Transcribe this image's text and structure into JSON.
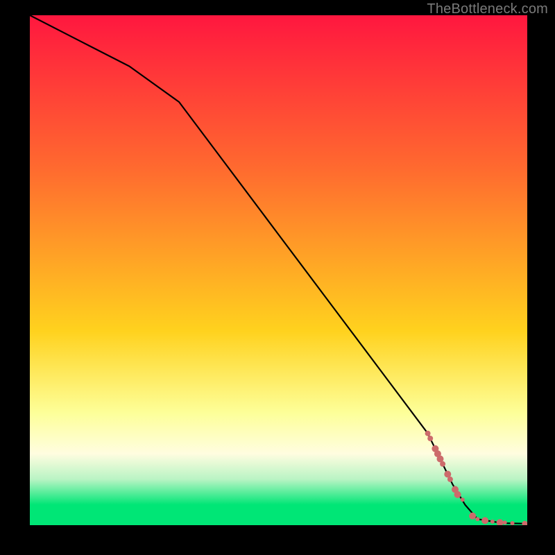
{
  "attribution": "TheBottleneck.com",
  "colors": {
    "top": "#ff173f",
    "mid1": "#ff6a2f",
    "mid2": "#ffd21e",
    "band_pale": "#fdff99",
    "band_cream": "#fffde0",
    "band_mint": "#b9f4c4",
    "green": "#00e676",
    "line": "#000000",
    "marker": "#cc6b6b"
  },
  "chart_data": {
    "type": "line",
    "title": "",
    "xlabel": "",
    "ylabel": "",
    "xlim": [
      0,
      100
    ],
    "ylim": [
      0,
      100
    ],
    "series": [
      {
        "name": "curve",
        "x": [
          0,
          10,
          20,
          30,
          40,
          50,
          60,
          70,
          80,
          82.5,
          85,
          87.5,
          90,
          95,
          100
        ],
        "y": [
          100,
          95,
          90,
          83,
          70,
          57,
          44,
          31,
          18,
          13,
          8,
          4,
          1.2,
          0.4,
          0.3
        ]
      }
    ],
    "markers": {
      "name": "highlight",
      "points": [
        {
          "x": 80.0,
          "y": 18.0,
          "r": 4
        },
        {
          "x": 80.5,
          "y": 17.0,
          "r": 4
        },
        {
          "x": 81.5,
          "y": 15.0,
          "r": 5
        },
        {
          "x": 82.0,
          "y": 14.0,
          "r": 5
        },
        {
          "x": 82.5,
          "y": 13.0,
          "r": 5
        },
        {
          "x": 83.0,
          "y": 12.0,
          "r": 4
        },
        {
          "x": 84.0,
          "y": 10.0,
          "r": 5
        },
        {
          "x": 84.5,
          "y": 9.0,
          "r": 4
        },
        {
          "x": 85.5,
          "y": 7.0,
          "r": 5
        },
        {
          "x": 86.0,
          "y": 6.0,
          "r": 5
        },
        {
          "x": 87.0,
          "y": 5.0,
          "r": 3
        },
        {
          "x": 89.0,
          "y": 1.8,
          "r": 5
        },
        {
          "x": 90.0,
          "y": 1.2,
          "r": 3
        },
        {
          "x": 91.5,
          "y": 0.9,
          "r": 5
        },
        {
          "x": 93.0,
          "y": 0.7,
          "r": 3
        },
        {
          "x": 94.5,
          "y": 0.5,
          "r": 5
        },
        {
          "x": 95.5,
          "y": 0.5,
          "r": 3
        },
        {
          "x": 97.0,
          "y": 0.4,
          "r": 3
        },
        {
          "x": 99.5,
          "y": 0.3,
          "r": 4
        }
      ]
    },
    "gradient_stops": [
      {
        "pct": 0,
        "key": "top"
      },
      {
        "pct": 30,
        "key": "mid1"
      },
      {
        "pct": 62,
        "key": "mid2"
      },
      {
        "pct": 78,
        "key": "band_pale"
      },
      {
        "pct": 86,
        "key": "band_cream"
      },
      {
        "pct": 91,
        "key": "band_mint"
      },
      {
        "pct": 96,
        "key": "green"
      },
      {
        "pct": 100,
        "key": "green"
      }
    ]
  }
}
